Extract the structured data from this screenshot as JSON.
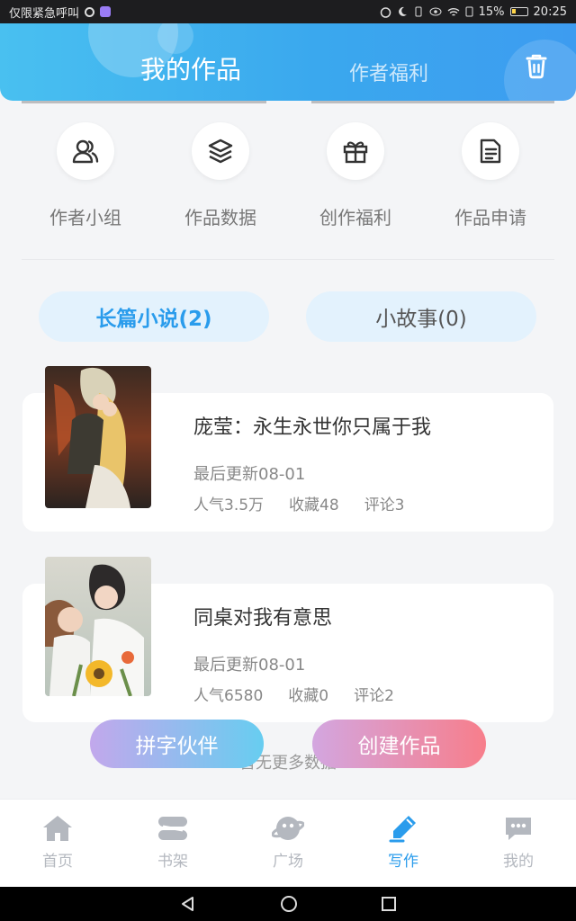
{
  "status_bar": {
    "left_text": "仅限紧急呼叫",
    "battery": "15%",
    "time": "20:25"
  },
  "header": {
    "tab_active": "我的作品",
    "tab_inactive": "作者福利",
    "trash_icon": "trash-icon"
  },
  "quick_actions": [
    {
      "label": "作者小组",
      "icon": "group-icon"
    },
    {
      "label": "作品数据",
      "icon": "layers-icon"
    },
    {
      "label": "创作福利",
      "icon": "gift-icon"
    },
    {
      "label": "作品申请",
      "icon": "document-icon"
    }
  ],
  "category_tabs": {
    "novel": "长篇小说(2)",
    "story": "小故事(0)"
  },
  "works": [
    {
      "title": "庞莹：永生永世你只属于我",
      "updated": "最后更新08-01",
      "popularity": "人气3.5万",
      "favorites": "收藏48",
      "comments": "评论3"
    },
    {
      "title": "同桌对我有意思",
      "updated": "最后更新08-01",
      "popularity": "人气6580",
      "favorites": "收藏0",
      "comments": "评论2"
    }
  ],
  "list_footer": "暂无更多数据",
  "fab": {
    "partner": "拼字伙伴",
    "create": "创建作品"
  },
  "bottom_nav": [
    {
      "label": "首页",
      "icon": "home-icon"
    },
    {
      "label": "书架",
      "icon": "bookshelf-icon"
    },
    {
      "label": "广场",
      "icon": "planet-icon"
    },
    {
      "label": "写作",
      "icon": "pen-icon",
      "active": true
    },
    {
      "label": "我的",
      "icon": "chat-bubble-icon"
    }
  ],
  "colors": {
    "accent": "#2a9cec",
    "header_gradient_start": "#49c0f0",
    "header_gradient_end": "#3d9cf0",
    "create_button": "#f77e8b"
  }
}
